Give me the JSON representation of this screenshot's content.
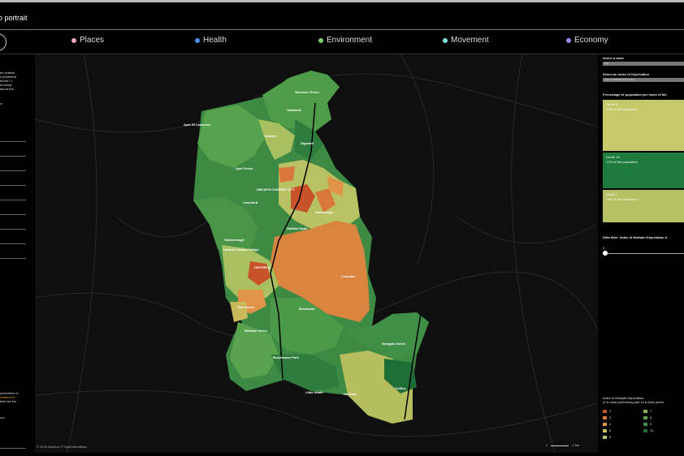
{
  "header": {
    "title": "o portrait"
  },
  "nav": {
    "tabs": [
      {
        "label": "Places",
        "color": "#f4a6c8"
      },
      {
        "label": "Health",
        "color": "#4a90e2"
      },
      {
        "label": "Environment",
        "color": "#7ed16b"
      },
      {
        "label": "Movement",
        "color": "#7fe0e0"
      },
      {
        "label": "Economy",
        "color": "#9a8cf0"
      }
    ]
  },
  "left_panel": {
    "intro_lines": [
      "es relative",
      "s published",
      "break? 1",
      "al below",
      "about the"
    ],
    "cr_line": "cr",
    "foot_lines": [
      "authorities in",
      "Watford to",
      "tries for the"
    ],
    "foot_last": "our"
  },
  "map": {
    "attribution": "© 2024 Mapbox © OpenStreetMap",
    "scale_left": "1",
    "scale_right": "2 km",
    "places": [
      "Woolmer Green",
      "Oaklands",
      "Ayot St Lawrence",
      "Welwyn",
      "Digswell",
      "Ayot Green",
      "WELWYN GARDEN CITY",
      "Lemsford",
      "Panshanger",
      "Hatfield Hyde",
      "Stanborough",
      "Hatfield Garden Village",
      "HATFIELD",
      "Lemsden",
      "Roe Green",
      "Brookside",
      "Welham Green",
      "Brookmans Park",
      "Newgate Street",
      "Little Heath",
      "Northaw",
      "Cuffley"
    ]
  },
  "right_panel": {
    "select_ward_label": "Select a ward",
    "select_ward_value": "(all)",
    "select_index_label": "Select an Index of Deprivation",
    "select_index_value": "Index of Multiple Deprivation",
    "percentage_label": "Percentage of population per Index of Mu",
    "bars": [
      {
        "label": "Decile 8",
        "sub": "32% of the population",
        "color": "#c5c96a"
      },
      {
        "label": "Decile 10",
        "sub": "17% of the population",
        "color": "#1f7a3d"
      },
      {
        "label": "Decile 7",
        "sub": "15% of the population",
        "color": "#b7c062"
      }
    ],
    "slider_label": "Data filter: Index of Multiple Deprivation d",
    "slider_min": "2",
    "legend_title": "Index of Multiple Deprivation",
    "legend_subtitle": "(1 is most performing and 10 is best perfor",
    "legend": [
      {
        "label": "2",
        "color": "#c8532b"
      },
      {
        "label": "3",
        "color": "#d8773a"
      },
      {
        "label": "4",
        "color": "#e09448"
      },
      {
        "label": "5",
        "color": "#c9b85c"
      },
      {
        "label": "6",
        "color": "#b5c465"
      },
      {
        "label": "7",
        "color": "#8fb257"
      },
      {
        "label": "8",
        "color": "#5ea44d"
      },
      {
        "label": "9",
        "color": "#3f9046"
      },
      {
        "label": "10",
        "color": "#1f6e38"
      }
    ]
  }
}
